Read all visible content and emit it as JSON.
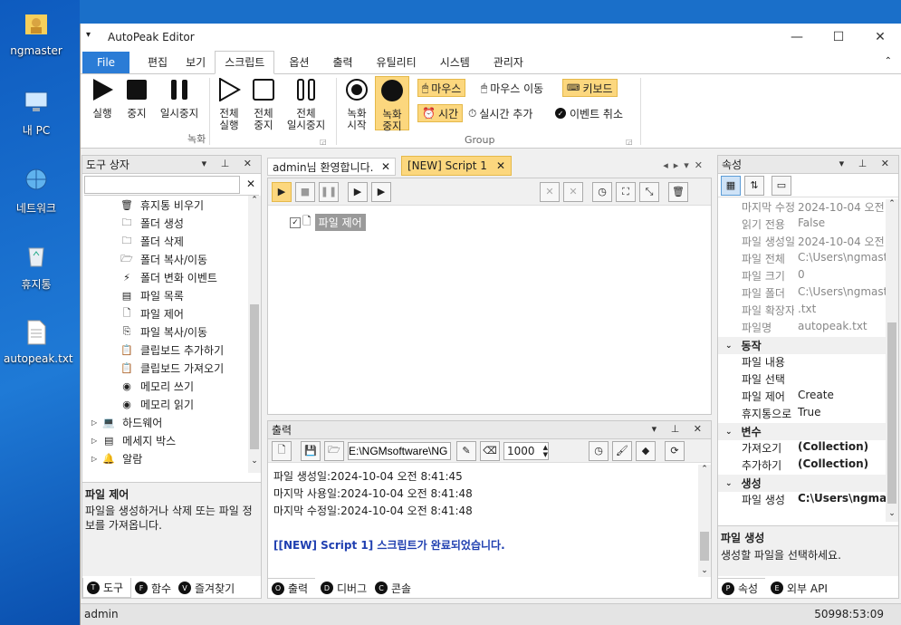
{
  "desktop": {
    "icons": [
      {
        "label": "ngmaster",
        "icon": "folder-user-icon"
      },
      {
        "label": "내 PC",
        "icon": "computer-icon"
      },
      {
        "label": "네트워크",
        "icon": "network-icon"
      },
      {
        "label": "휴지통",
        "icon": "recycle-bin-icon"
      },
      {
        "label": "autopeak.txt",
        "icon": "text-file-icon"
      }
    ]
  },
  "window": {
    "title": "AutoPeak Editor"
  },
  "menu": {
    "file": "File",
    "tabs": [
      "편집",
      "보기",
      "스크립트",
      "옵션",
      "출력",
      "유틸리티",
      "시스템",
      "관리자"
    ],
    "active": "스크립트"
  },
  "ribbon": {
    "rec_buttons": [
      {
        "label1": "실행",
        "label2": ""
      },
      {
        "label1": "중지",
        "label2": ""
      },
      {
        "label1": "일시중지",
        "label2": ""
      },
      {
        "label1": "전체",
        "label2": "실행"
      },
      {
        "label1": "전체",
        "label2": "중지"
      },
      {
        "label1": "전체",
        "label2": "일시중지"
      }
    ],
    "rec_group": "녹화",
    "record_start": [
      "녹화",
      "시작"
    ],
    "record_stop": [
      "녹화",
      "중지"
    ],
    "mouse": "마우스",
    "mouse_move": "마우스 이동",
    "keyboard": "키보드",
    "time": "시간",
    "realtime_add": "실시간 추가",
    "event_cancel": "이벤트 취소",
    "group2": "Group"
  },
  "toolbox": {
    "title": "도구 상자",
    "items": [
      "휴지통 비우기",
      "폴더 생성",
      "폴더 삭제",
      "폴더 복사/이동",
      "폴더 변화 이벤트",
      "파일 목록",
      "파일 제어",
      "파일 복사/이동",
      "클립보드 추가하기",
      "클립보드 가져오기",
      "메모리 쓰기",
      "메모리 읽기"
    ],
    "groups": [
      "하드웨어",
      "메세지 박스",
      "알람"
    ],
    "desc_title": "파일 제어",
    "desc_text": "파일을 생성하거나 삭제 또는 파일 정보를 가져옵니다.",
    "tabs": [
      "도구",
      "함수",
      "즐겨찾기"
    ],
    "tab_letters": [
      "T",
      "F",
      "V"
    ]
  },
  "editor": {
    "tabs": [
      "admin님 환영합니다.",
      "[NEW] Script 1"
    ],
    "node": "파일 제어"
  },
  "output": {
    "title": "출력",
    "path": "E:\\NGMsoftware\\NG",
    "count": "1000",
    "lines": [
      "파일 생성일:2024-10-04 오전 8:41:45",
      "마지막 사용일:2024-10-04 오전 8:41:48",
      "마지막 수정일:2024-10-04 오전 8:41:48",
      "",
      "[[NEW] Script 1] 스크립트가 완료되었습니다."
    ],
    "tabs": [
      "출력",
      "디버그",
      "콘솔"
    ],
    "tab_letters": [
      "O",
      "D",
      "C"
    ]
  },
  "properties": {
    "title": "속성",
    "rows_ro": [
      [
        "마지막 수정",
        "2024-10-04 오전"
      ],
      [
        "읽기 전용",
        "False"
      ],
      [
        "파일 생성일",
        "2024-10-04 오전"
      ],
      [
        "파일 전체",
        "C:\\Users\\ngmast"
      ],
      [
        "파일 크기",
        "0"
      ],
      [
        "파일 폴더",
        "C:\\Users\\ngmast"
      ],
      [
        "파일 확장자",
        ".txt"
      ],
      [
        "파일명",
        "autopeak.txt"
      ]
    ],
    "cat1": "동작",
    "rows1": [
      [
        "파일 내용",
        ""
      ],
      [
        "파일 선택",
        ""
      ],
      [
        "파일 제어",
        "Create"
      ],
      [
        "휴지통으로",
        "True"
      ]
    ],
    "cat2": "변수",
    "rows2": [
      [
        "가져오기",
        "(Collection)"
      ],
      [
        "추가하기",
        "(Collection)"
      ]
    ],
    "cat3": "생성",
    "rows3": [
      [
        "파일 생성",
        "C:\\Users\\ngma"
      ]
    ],
    "desc_title": "파일 생성",
    "desc_text": "생성할 파일을 선택하세요.",
    "tabs": [
      "속성",
      "외부 API"
    ],
    "tab_letters": [
      "P",
      "E"
    ]
  },
  "status": {
    "user": "admin",
    "time": "50998:53:09"
  }
}
